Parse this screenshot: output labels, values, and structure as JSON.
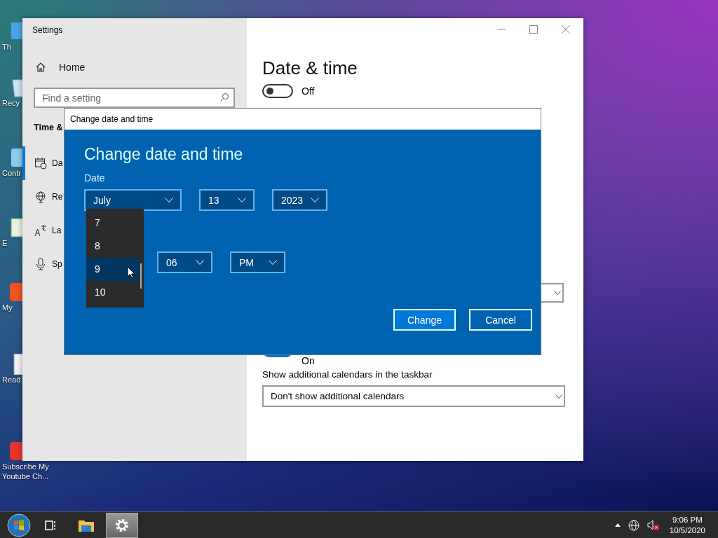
{
  "desktop": {
    "icons": [
      {
        "label": "Th",
        "kind": "monitor"
      },
      {
        "label": "Recy",
        "kind": "bin"
      },
      {
        "label": "Contr",
        "kind": "panel"
      },
      {
        "label": "E",
        "kind": "editor"
      },
      {
        "label": "My",
        "kind": "orange"
      },
      {
        "label": "Read",
        "kind": "doc"
      },
      {
        "label": "Subscribe My Youtube Ch...",
        "kind": "red"
      }
    ]
  },
  "settings_window": {
    "title": "Settings",
    "sidebar": {
      "home": "Home",
      "search": {
        "placeholder": "Find a setting"
      },
      "section": "Time &",
      "items": [
        {
          "label": "Da",
          "kind": "calendar",
          "selected": true
        },
        {
          "label": "Re",
          "kind": "globe",
          "selected": false
        },
        {
          "label": "La",
          "kind": "language",
          "selected": false
        },
        {
          "label": "Sp",
          "kind": "mic",
          "selected": false
        }
      ]
    },
    "content": {
      "heading": "Date & time",
      "toggle_top": {
        "on": false,
        "label": "Off"
      },
      "toggle_bottom": {
        "on": true,
        "label": "On"
      },
      "calendars_label": "Show additional calendars in the taskbar",
      "calendars_dropdown": {
        "value": "Don't show additional calendars"
      }
    }
  },
  "dialog": {
    "title": "Change date and time",
    "heading": "Change date and time",
    "date_label": "Date",
    "date_fields": [
      {
        "value": "July"
      },
      {
        "value": "13"
      },
      {
        "value": "2023"
      }
    ],
    "time_fields": [
      {
        "value": "06"
      },
      {
        "value": "PM"
      }
    ],
    "hour_list": [
      {
        "label": "7",
        "selected": false
      },
      {
        "label": "8",
        "selected": false
      },
      {
        "label": "9",
        "selected": true
      },
      {
        "label": "10",
        "selected": false
      }
    ],
    "buttons": [
      {
        "label": "Change",
        "kind": "primary"
      },
      {
        "label": "Cancel",
        "kind": "secondary"
      }
    ]
  },
  "taskbar": {
    "apps": [
      {
        "kind": "taskview",
        "selected": false
      },
      {
        "kind": "folder",
        "selected": false
      },
      {
        "kind": "gear",
        "selected": true
      }
    ],
    "time": "9:06 PM",
    "date": "10/5/2020"
  }
}
